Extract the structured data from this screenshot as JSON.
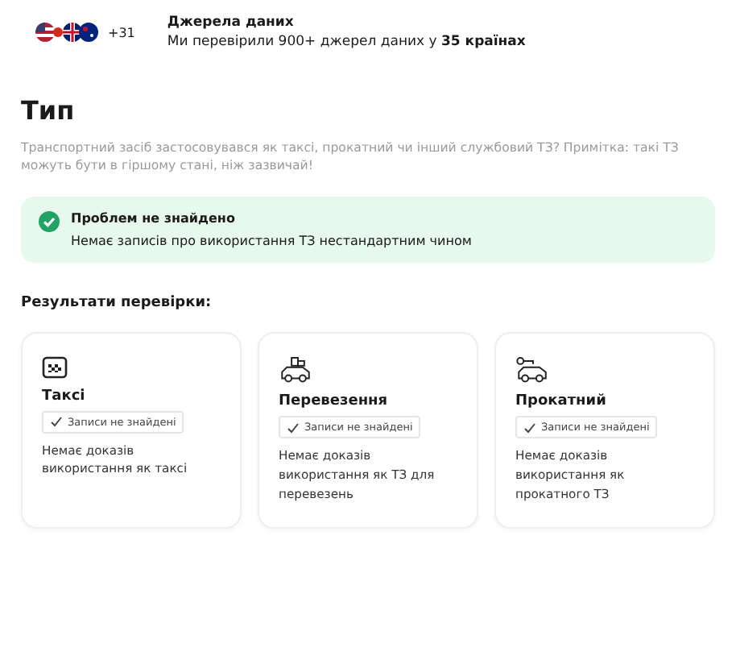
{
  "sources": {
    "count": "+31",
    "title": "Джерела даних",
    "subtitle": "Ми перевірили 900+ джерел даних у **35 країнах**"
  },
  "section": {
    "title": "Тип",
    "description": "Транспортний засіб застосовувався як таксі, прокатний чи інший службовий ТЗ? Примітка: такі ТЗ можуть бути в гіршому стані, ніж зазвичай!"
  },
  "alert": {
    "title": "Проблем не знайдено",
    "text": "Немає записів про використання ТЗ нестандартним чином"
  },
  "results_title": "Результати перевірки:",
  "cards": [
    {
      "kind": "taxi",
      "title": "Таксі",
      "badge": "Записи не знайдені",
      "text": "Немає доказів використання як таксі"
    },
    {
      "kind": "transport",
      "title": "Перевезення",
      "badge": "Записи не знайдені",
      "text": "Немає доказів використання як ТЗ для перевезень"
    },
    {
      "kind": "rental",
      "title": "Прокатний",
      "badge": "Записи не знайдені",
      "text": "Немає доказів використання як прокатного ТЗ"
    }
  ]
}
